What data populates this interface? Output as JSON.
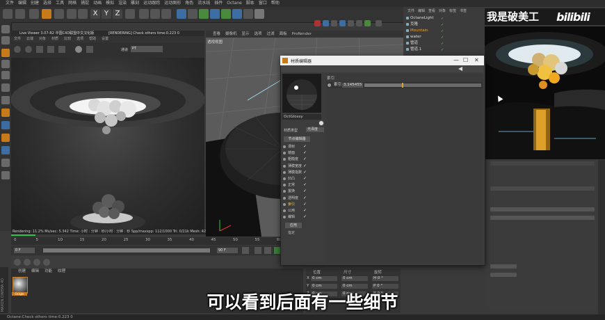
{
  "menubar": {
    "items": [
      "文件",
      "编辑",
      "创建",
      "选择",
      "工具",
      "网格",
      "捕捉",
      "动画",
      "模拟",
      "渲染",
      "雕刻",
      "运动跟踪",
      "运动图形",
      "角色",
      "流水线",
      "插件",
      "Octane",
      "脚本",
      "窗口",
      "帮助"
    ]
  },
  "toolbar": {
    "xyz": [
      "X",
      "Y",
      "Z"
    ]
  },
  "live_viewer": {
    "title": "Live Viewer 3.07-R2 中国C4D联盟中文汉化版",
    "status_msg": "[RENDERING] Check others time:0.223  0",
    "menu": [
      "文件",
      "云端",
      "对象",
      "材质",
      "比较",
      "选项",
      "帮助",
      "设置"
    ],
    "mode": "PT",
    "info_line": "Rendering: 11.2%   Ms/sec: 5.342   Time: 小时 : 分钟 : 秒/小时 : 分钟 : 秒   Spp/maxspp: 112/1000   Tri: 0/21k   Mesh: 42   Hair: 0"
  },
  "viewport": {
    "menu": [
      "查看",
      "摄像机",
      "显示",
      "选项",
      "过滤",
      "面板",
      "ProRender"
    ],
    "label": "透视视图"
  },
  "timeline": {
    "ticks": [
      "0",
      "5",
      "10",
      "15",
      "20",
      "25",
      "30",
      "35",
      "40",
      "45",
      "50",
      "55",
      "60"
    ],
    "start": "0 F",
    "end": "90 F"
  },
  "material_panel": {
    "tabs": [
      "创建",
      "编辑",
      "功能",
      "纹理"
    ],
    "thumb_label": "Octglo"
  },
  "coordinates": {
    "headers": [
      "位置",
      "尺寸",
      "旋转"
    ],
    "rows": [
      {
        "axis": "X",
        "pos": "0 cm",
        "size": "0 cm",
        "rot": "H 0 °"
      },
      {
        "axis": "Y",
        "pos": "0 cm",
        "size": "0 cm",
        "rot": "P 0 °"
      },
      {
        "axis": "Z",
        "pos": "0 cm",
        "size": "0 cm",
        "rot": "B 0 °"
      }
    ]
  },
  "object_manager": {
    "tabs": [
      "文件",
      "编辑",
      "查看",
      "对象",
      "标签",
      "书签"
    ],
    "objects": [
      {
        "name": "OctaneLight",
        "highlight": false
      },
      {
        "name": "克隆",
        "highlight": false
      },
      {
        "name": "Mountain",
        "highlight": true
      },
      {
        "name": "water",
        "highlight": false
      },
      {
        "name": "管道",
        "highlight": false
      },
      {
        "name": "管道.1",
        "highlight": false
      }
    ]
  },
  "watermark": {
    "text": "我是破美工",
    "brand": "bilibili"
  },
  "material_editor": {
    "title": "材质编辑器",
    "material_name": "OctGlossy",
    "material_type_label": "材质类型",
    "material_type_value": "光泽度",
    "node_editor_btn": "节点编辑器",
    "channels": [
      {
        "label": "漫射",
        "checked": true,
        "active": false
      },
      {
        "label": "镜面",
        "checked": true,
        "active": false
      },
      {
        "label": "粗糙度",
        "checked": true,
        "active": false
      },
      {
        "label": "薄膜宽度",
        "checked": true,
        "active": false
      },
      {
        "label": "薄膜指数",
        "checked": true,
        "active": false
      },
      {
        "label": "凹凸",
        "checked": true,
        "active": false
      },
      {
        "label": "正常",
        "checked": true,
        "active": false
      },
      {
        "label": "置换",
        "checked": true,
        "active": false
      },
      {
        "label": "透明度",
        "checked": true,
        "active": false
      },
      {
        "label": "索引",
        "checked": true,
        "active": true
      },
      {
        "label": "公用",
        "checked": true,
        "active": false
      },
      {
        "label": "编辑",
        "checked": true,
        "active": false
      }
    ],
    "apply_btn": "应用",
    "assign_label": "指定",
    "param_section": "索引",
    "param_label": "索引",
    "param_value": "3.145455",
    "param_fraction": 0.32
  },
  "status_bar": "Octane:Check others time:0.223  0",
  "subtitle": "可以看到后面有一些细节"
}
